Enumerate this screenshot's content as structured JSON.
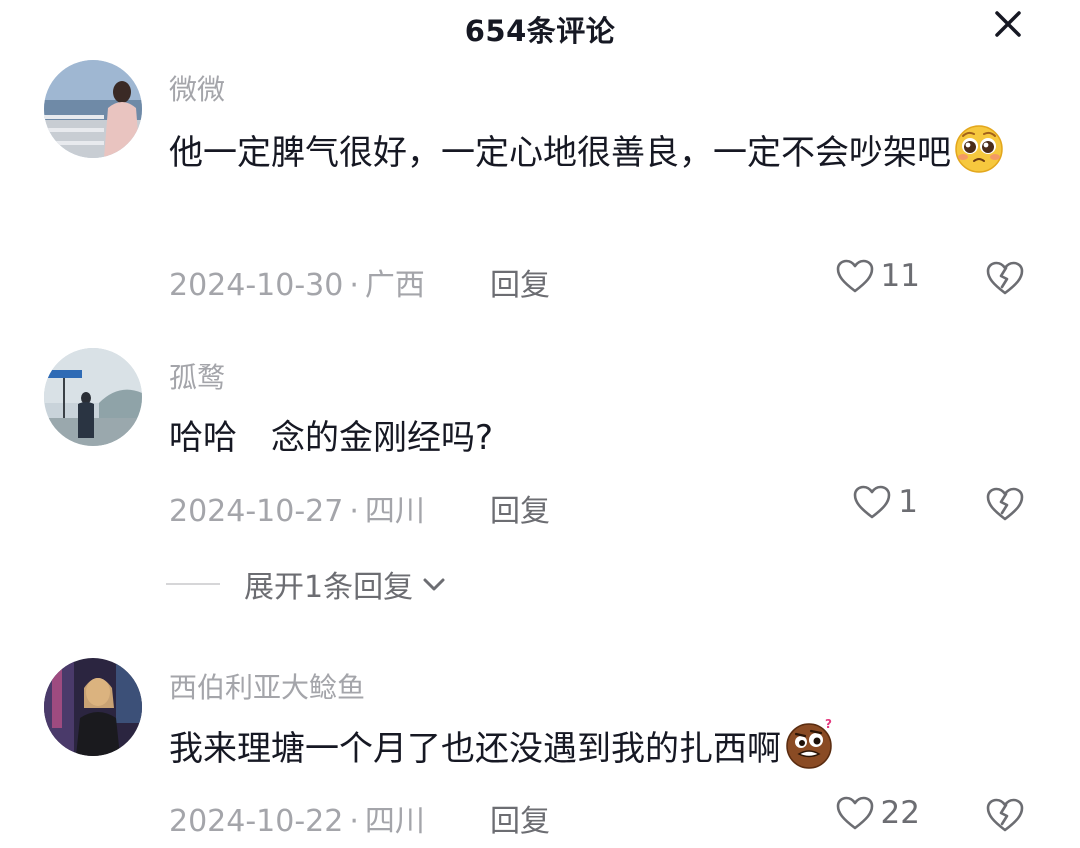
{
  "header": {
    "title": "654条评论",
    "close_icon": "close-icon"
  },
  "comments": [
    {
      "username": "微微",
      "text": "他一定脾气很好，一定心地很善良，一定不会吵架吧",
      "emoji": "pleading-face-emoji",
      "date": "2024-10-30",
      "separator": "·",
      "location": "广西",
      "reply_label": "回复",
      "likes": "11"
    },
    {
      "username": "孤鹜",
      "text": "哈哈　念的金刚经吗?",
      "date": "2024-10-27",
      "separator": "·",
      "location": "四川",
      "reply_label": "回复",
      "likes": "1",
      "expand_label": "展开1条回复"
    },
    {
      "username": "西伯利亚大鲶鱼",
      "text": "我来理塘一个月了也还没遇到我的扎西啊",
      "emoji": "confused-face-emoji",
      "date": "2024-10-22",
      "separator": "·",
      "location": "四川",
      "reply_label": "回复",
      "likes": "22"
    }
  ],
  "colors": {
    "text": "#161823",
    "secondary": "#a4a5aa",
    "action": "#6c6d72"
  }
}
